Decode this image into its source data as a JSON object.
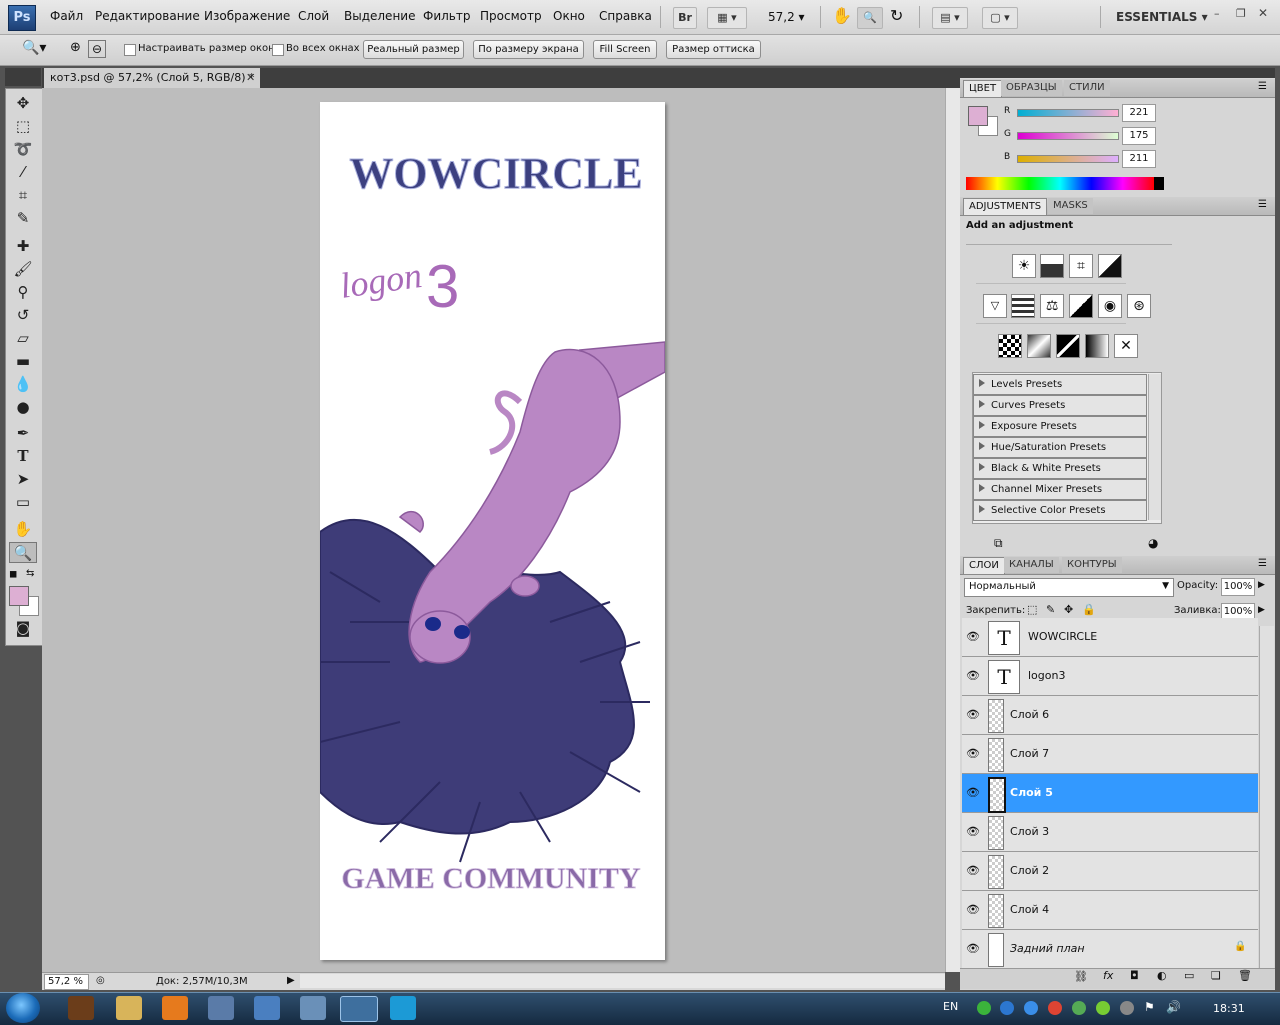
{
  "app": {
    "logo": "Ps"
  },
  "menu": [
    "Файл",
    "Редактирование",
    "Изображение",
    "Слой",
    "Выделение",
    "Фильтр",
    "Просмотр",
    "Окно",
    "Справка"
  ],
  "menubar_right": {
    "bridge": "Br",
    "zoom": "57,2",
    "workspace": "ESSENTIALS"
  },
  "options": {
    "resize_windows": "Настраивать размер окон",
    "all_windows": "Во всех окнах",
    "actual_pixels": "Реальный размер",
    "fit_screen": "По размеру экрана",
    "fill_screen": "Fill Screen",
    "print_size": "Размер оттиска"
  },
  "document": {
    "tab_title": "кот3.psd @ 57,2% (Слой 5, RGB/8) *",
    "title_text": "WOWCIRCLE",
    "logo_text": "logon",
    "logo_number": "3",
    "footer_text": "GAME COMMUNITY"
  },
  "status": {
    "zoom": "57,2 %",
    "doc_size": "Док: 2,57M/10,3M"
  },
  "color_panel": {
    "tabs": [
      "ЦВЕТ",
      "ОБРАЗЦЫ",
      "СТИЛИ"
    ],
    "channels": [
      {
        "label": "R",
        "value": "221"
      },
      {
        "label": "G",
        "value": "175"
      },
      {
        "label": "B",
        "value": "211"
      }
    ],
    "foreground": "#ddafd3"
  },
  "adjustments_panel": {
    "tabs": [
      "ADJUSTMENTS",
      "MASKS"
    ],
    "heading": "Add an adjustment",
    "presets": [
      "Levels Presets",
      "Curves Presets",
      "Exposure Presets",
      "Hue/Saturation Presets",
      "Black & White Presets",
      "Channel Mixer Presets",
      "Selective Color Presets"
    ]
  },
  "layers_panel": {
    "tabs": [
      "СЛОИ",
      "КАНАЛЫ",
      "КОНТУРЫ"
    ],
    "blend_mode": "Нормальный",
    "opacity_label": "Opacity:",
    "opacity": "100%",
    "lock_label": "Закрепить:",
    "fill_label": "Заливка:",
    "fill": "100%",
    "layers": [
      {
        "name": "WOWCIRCLE",
        "type": "text"
      },
      {
        "name": "logon3",
        "type": "text"
      },
      {
        "name": "Слой 6",
        "type": "raster"
      },
      {
        "name": "Слой 7",
        "type": "raster"
      },
      {
        "name": "Слой 5",
        "type": "raster",
        "selected": true
      },
      {
        "name": "Слой 3",
        "type": "raster"
      },
      {
        "name": "Слой 2",
        "type": "raster"
      },
      {
        "name": "Слой 4",
        "type": "raster"
      },
      {
        "name": "Задний план",
        "type": "background"
      }
    ]
  },
  "taskbar": {
    "language": "EN",
    "time": "18:31"
  }
}
